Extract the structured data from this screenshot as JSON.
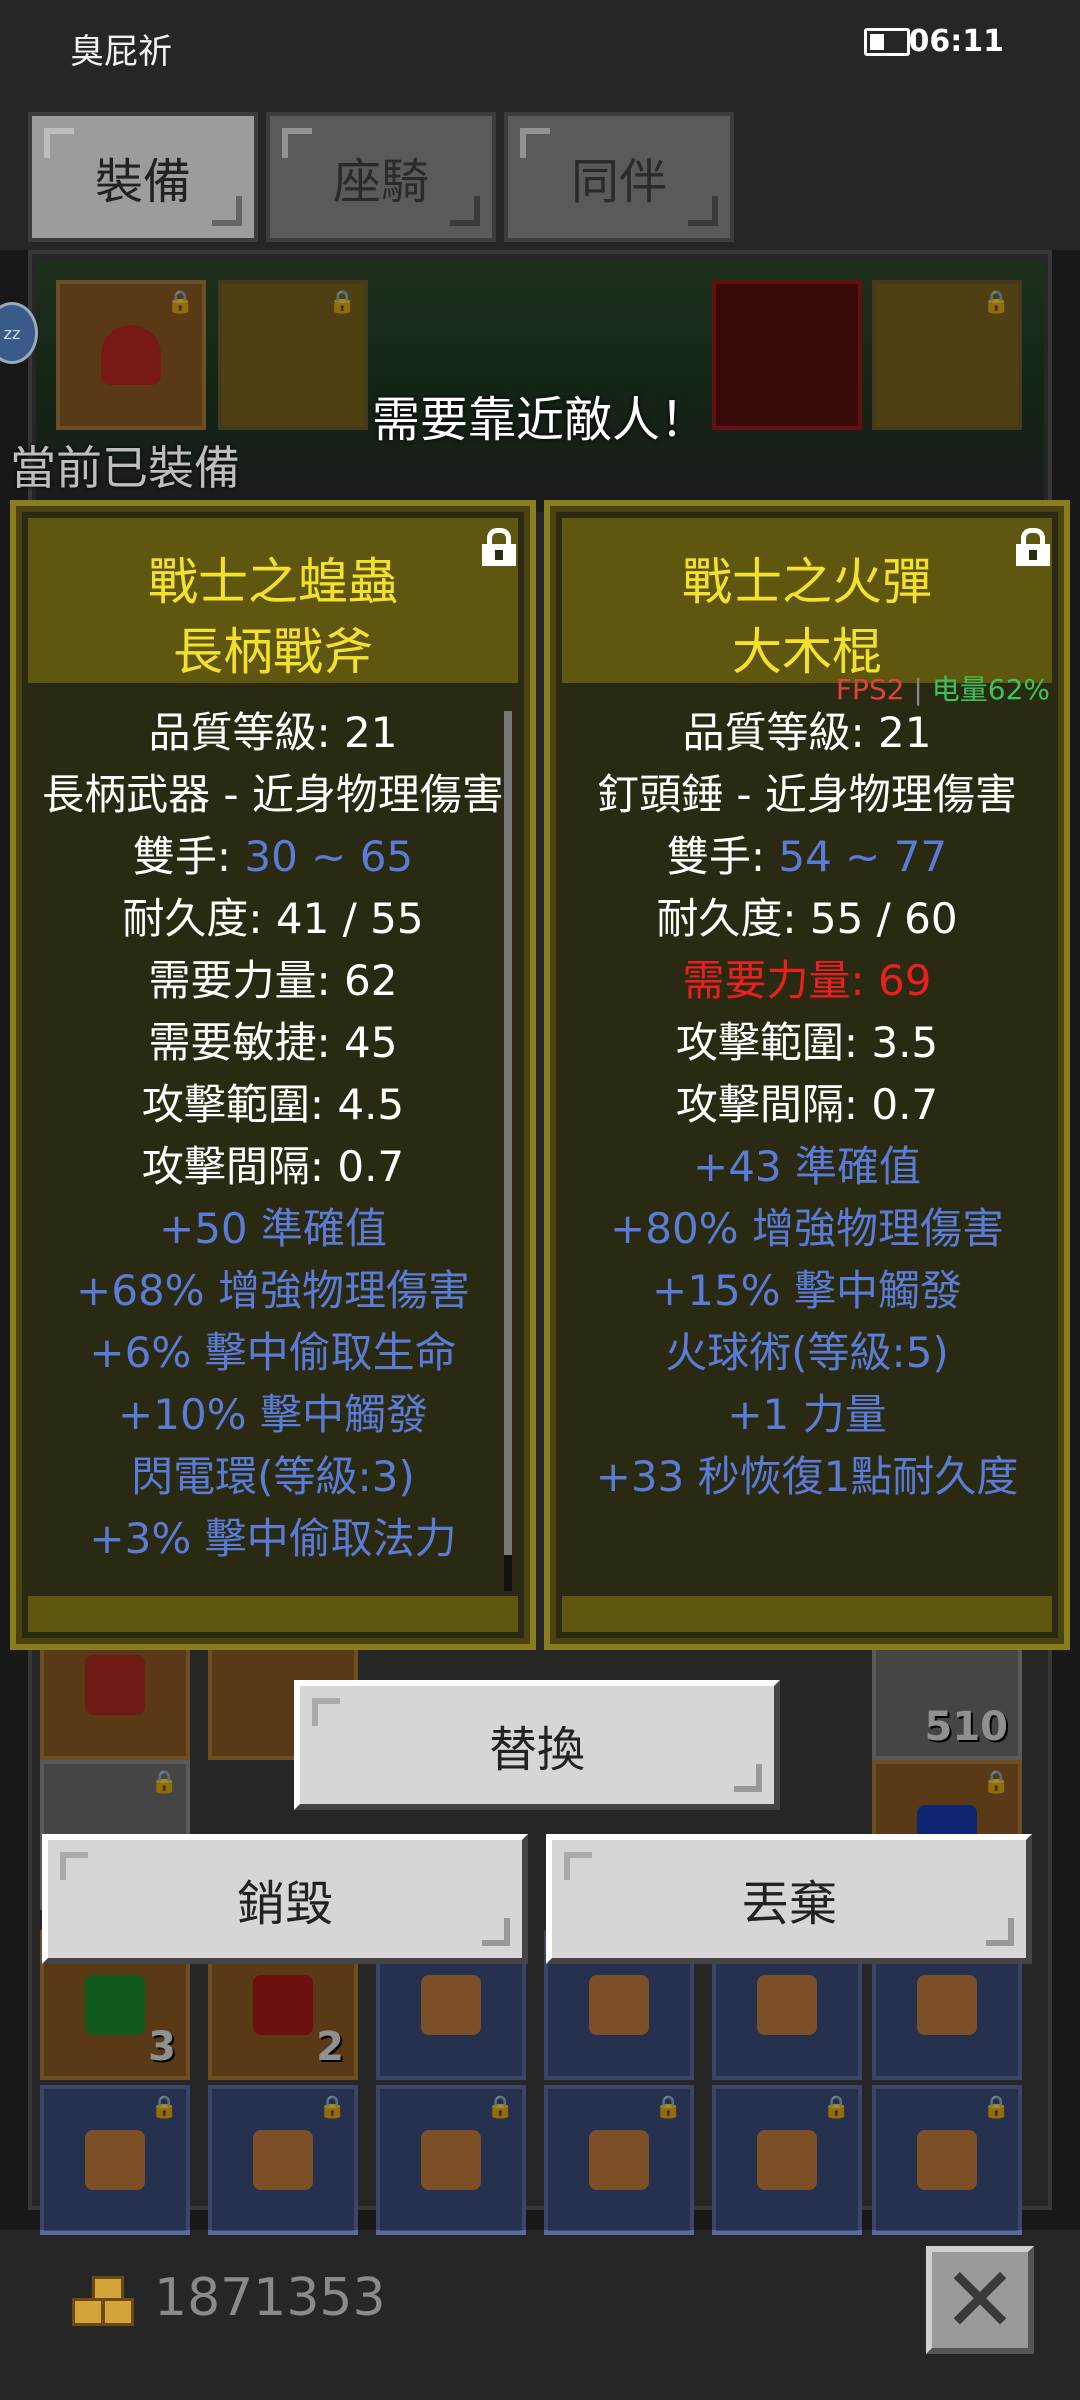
{
  "status_bar": {
    "app_name": "臭屁祈",
    "time": "06:11"
  },
  "tabs": [
    {
      "label": "裝備"
    },
    {
      "label": "座騎"
    },
    {
      "label": "同伴"
    }
  ],
  "toast": "需要靠近敵人！",
  "equipped_label": "當前已裝備",
  "overlay": {
    "fps": "FPS2",
    "battery": "电量62%"
  },
  "left_item": {
    "name_line1": "戰士之蝗蟲",
    "name_line2": "長柄戰斧",
    "stats": [
      {
        "text": "品質等級: 21"
      },
      {
        "text": "長柄武器 - 近身物理傷害"
      },
      {
        "label": "雙手: ",
        "value": "30 ~ 65"
      },
      {
        "text": "耐久度: 41 / 55"
      },
      {
        "text": "需要力量: 62"
      },
      {
        "text": "需要敏捷: 45"
      },
      {
        "text": "攻擊範圍: 4.5"
      },
      {
        "text": "攻擊間隔: 0.7"
      },
      {
        "text": "+50 準確值",
        "blue": true
      },
      {
        "text": "+68% 增強物理傷害",
        "blue": true
      },
      {
        "text": "+6% 擊中偷取生命",
        "blue": true
      },
      {
        "text": "+10% 擊中觸發",
        "blue": true
      },
      {
        "text": "閃電環(等級:3)",
        "blue": true
      },
      {
        "text": "+3% 擊中偷取法力",
        "blue": true
      }
    ]
  },
  "right_item": {
    "name_line1": "戰士之火彈",
    "name_line2": "大木棍",
    "stats": [
      {
        "text": "品質等級: 21"
      },
      {
        "text": "釘頭錘 - 近身物理傷害"
      },
      {
        "label": "雙手: ",
        "value": "54 ~ 77"
      },
      {
        "text": "耐久度: 55 / 60"
      },
      {
        "text": "需要力量: 69",
        "red": true
      },
      {
        "text": "攻擊範圍: 3.5"
      },
      {
        "text": "攻擊間隔: 0.7"
      },
      {
        "text": "+43 準確值",
        "blue": true
      },
      {
        "text": "+80% 增強物理傷害",
        "blue": true
      },
      {
        "text": "+15% 擊中觸發",
        "blue": true
      },
      {
        "text": "火球術(等級:5)",
        "blue": true
      },
      {
        "text": "+1 力量",
        "blue": true
      },
      {
        "text": "+33 秒恢復1點耐久度",
        "blue": true
      }
    ]
  },
  "buttons": {
    "replace": "替換",
    "destroy": "銷毀",
    "discard": "丟棄"
  },
  "inventory_counts": {
    "stack_510": "510",
    "stack_3": "3",
    "stack_2": "2"
  },
  "gold": "1871353",
  "colors": {
    "title_yellow": "#f5e12a",
    "affix_blue": "#5a7bd6",
    "requirement_red": "#e8201e"
  }
}
